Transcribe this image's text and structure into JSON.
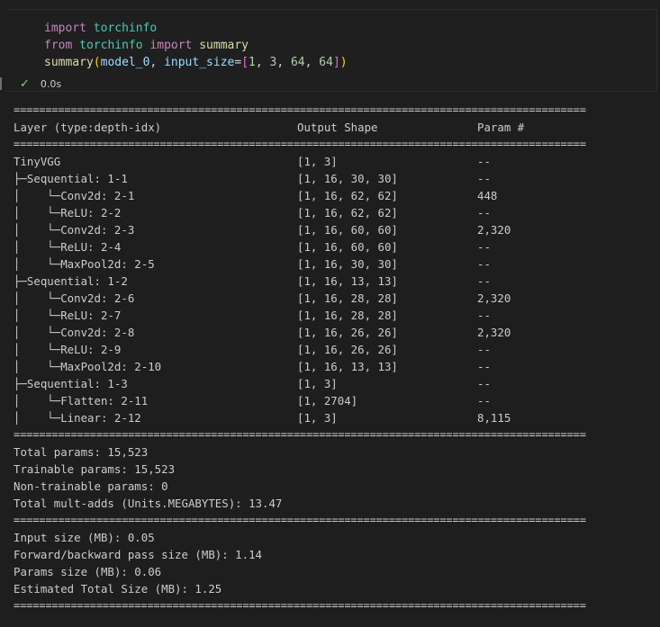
{
  "code": {
    "line1": {
      "kw": "import",
      "mod": "torchinfo"
    },
    "line2": {
      "kw1": "from",
      "mod": "torchinfo",
      "kw2": "import",
      "fn": "summary"
    },
    "line3": {
      "fn": "summary",
      "open": "(",
      "arg1": "model_0",
      "comma1": ", ",
      "kw": "input_size",
      "eq": "=",
      "lb": "[",
      "n1": "1",
      "c1": ", ",
      "n2": "3",
      "c2": ", ",
      "n3": "64",
      "c3": ", ",
      "n4": "64",
      "rb": "]",
      "close": ")"
    }
  },
  "status": {
    "duration": "0.0s"
  },
  "separator": "==========================================================================================",
  "header": {
    "layer": "Layer (type:depth-idx)",
    "shape": "Output Shape",
    "params": "Param #"
  },
  "rows": [
    {
      "layer": "TinyVGG",
      "shape": "[1, 3]",
      "params": "--"
    },
    {
      "layer": "├─Sequential: 1-1",
      "shape": "[1, 16, 30, 30]",
      "params": "--"
    },
    {
      "layer": "│    └─Conv2d: 2-1",
      "shape": "[1, 16, 62, 62]",
      "params": "448"
    },
    {
      "layer": "│    └─ReLU: 2-2",
      "shape": "[1, 16, 62, 62]",
      "params": "--"
    },
    {
      "layer": "│    └─Conv2d: 2-3",
      "shape": "[1, 16, 60, 60]",
      "params": "2,320"
    },
    {
      "layer": "│    └─ReLU: 2-4",
      "shape": "[1, 16, 60, 60]",
      "params": "--"
    },
    {
      "layer": "│    └─MaxPool2d: 2-5",
      "shape": "[1, 16, 30, 30]",
      "params": "--"
    },
    {
      "layer": "├─Sequential: 1-2",
      "shape": "[1, 16, 13, 13]",
      "params": "--"
    },
    {
      "layer": "│    └─Conv2d: 2-6",
      "shape": "[1, 16, 28, 28]",
      "params": "2,320"
    },
    {
      "layer": "│    └─ReLU: 2-7",
      "shape": "[1, 16, 28, 28]",
      "params": "--"
    },
    {
      "layer": "│    └─Conv2d: 2-8",
      "shape": "[1, 16, 26, 26]",
      "params": "2,320"
    },
    {
      "layer": "│    └─ReLU: 2-9",
      "shape": "[1, 16, 26, 26]",
      "params": "--"
    },
    {
      "layer": "│    └─MaxPool2d: 2-10",
      "shape": "[1, 16, 13, 13]",
      "params": "--"
    },
    {
      "layer": "├─Sequential: 1-3",
      "shape": "[1, 3]",
      "params": "--"
    },
    {
      "layer": "│    └─Flatten: 2-11",
      "shape": "[1, 2704]",
      "params": "--"
    },
    {
      "layer": "│    └─Linear: 2-12",
      "shape": "[1, 3]",
      "params": "8,115"
    }
  ],
  "totals": [
    "Total params: 15,523",
    "Trainable params: 15,523",
    "Non-trainable params: 0",
    "Total mult-adds (Units.MEGABYTES): 13.47"
  ],
  "sizes": [
    "Input size (MB): 0.05",
    "Forward/backward pass size (MB): 1.14",
    "Params size (MB): 0.06",
    "Estimated Total Size (MB): 1.25"
  ]
}
